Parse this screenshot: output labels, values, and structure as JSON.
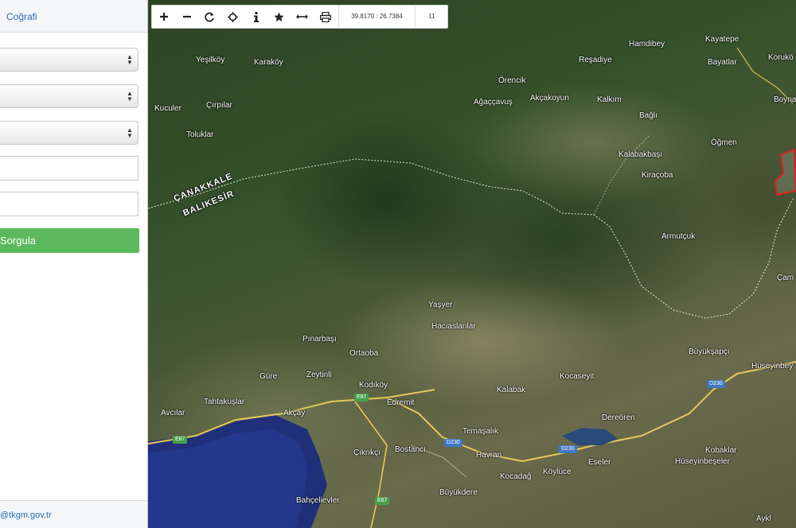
{
  "sidebar": {
    "tab_label": "Coğrafi",
    "query_button": "Sorgula",
    "footer_email": "@tkgm.gov.tr"
  },
  "toolbar": {
    "coordinates": "39.8170 : 26.7384",
    "zoom_level": "11",
    "icons": [
      "zoom-in-icon",
      "zoom-out-icon",
      "refresh-icon",
      "locate-icon",
      "info-icon",
      "star-icon",
      "measure-icon",
      "print-icon"
    ]
  },
  "map": {
    "provinces": {
      "north": "ÇANAKKALE",
      "south": "BALIKESİR"
    },
    "places": {
      "kayatepe": "Kayatepe",
      "hamdibey": "Hamdibey",
      "bayatlar": "Bayatlar",
      "korukoy": "Korukö",
      "yesilkoy": "Yeşilköy",
      "karakoy": "Karaköy",
      "resadiye": "Reşadiye",
      "orencik": "Örencik",
      "agacgavus": "Ağaççavuş",
      "akcakoyun": "Akçakoyun",
      "kalkim": "Kalkım",
      "boyna": "Boyna",
      "kuculer": "Kuculer",
      "ciftlar": "Çırpılar",
      "bagli": "Bağlı",
      "toluklar": "Toluklar",
      "ogmen": "Öğmen",
      "kalabakbasi": "Kalabakbaşı",
      "kiracoba": "Kiraçoba",
      "armutcuk": "Armutçuk",
      "cam": "Çam",
      "yasyer": "Yaşyer",
      "hacivelanlar": "Hacıaslanlar",
      "pinarbasi": "Pınarbaşı",
      "ortaoba": "Ortaoba",
      "buyuksapci": "Büyükşapçı",
      "huseyinbey": "Hüseyinbey",
      "gure": "Güre",
      "zeytinli": "Zeytinli",
      "kodikoy": "Kodıköy",
      "kocaseyit": "Kocaseyit",
      "edremit": "Edremit",
      "kalabak": "Kalabak",
      "tahtakuslar": "Tahtakuşlar",
      "avcilar": "Avcılar",
      "akcay": "Akçay",
      "dereoren": "Dereören",
      "temasalik": "Temaşalık",
      "kobaklar": "Kobaklar",
      "cikrikci": "Çıkrıkçı",
      "bostanci": "Bostancı",
      "havran": "Havran",
      "eseler": "Eseler",
      "huseyinbeseler": "Hüseyinbeşeler",
      "koylucce": "Köylüce",
      "kocadag": "Kocadağ",
      "buyukdere": "Büyükdere",
      "bahcelievler": "Bahçelievler",
      "aykli": "Aykl"
    },
    "road_shields": {
      "e87_a": "E87",
      "e87_b": "E87",
      "e87_c": "E87",
      "d230_a": "D230",
      "d230_b": "D230",
      "d230_c": "D230"
    }
  }
}
